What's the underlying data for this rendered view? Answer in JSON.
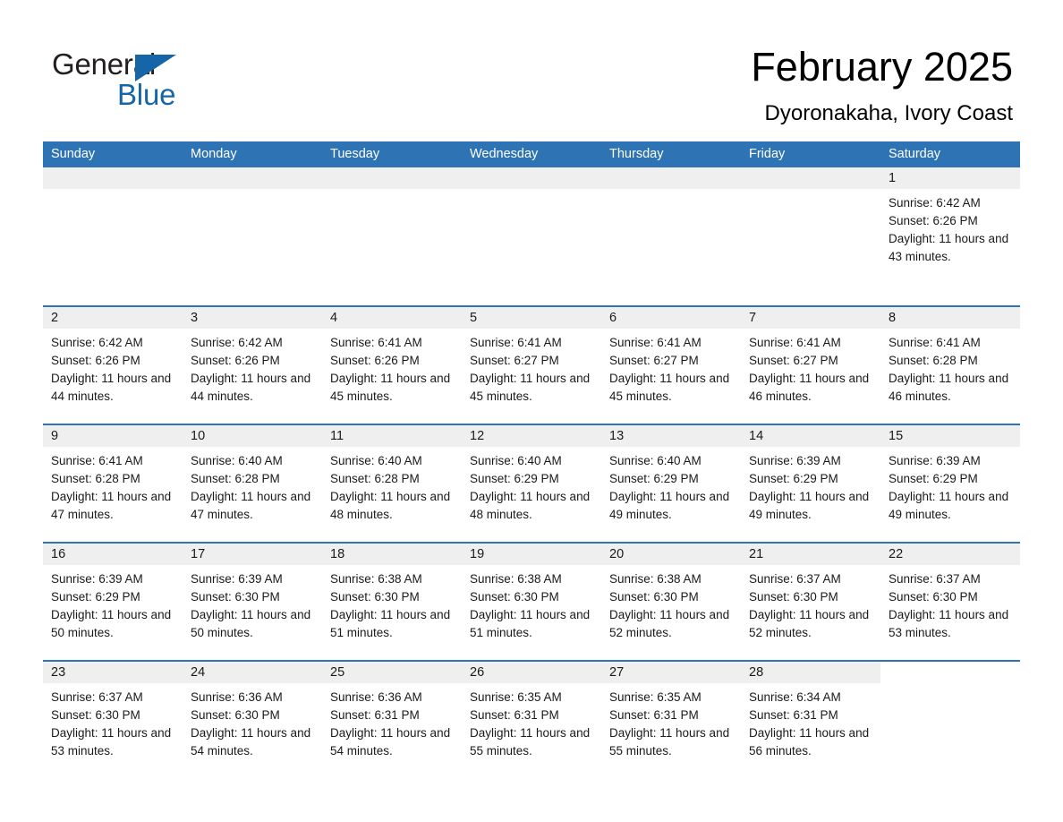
{
  "brand": {
    "name_part1": "General",
    "name_part2": "Blue",
    "accent_color": "#1565a8",
    "triangle_icon": "triangle-icon"
  },
  "header": {
    "title": "February 2025",
    "subtitle": "Dyoronakaha, Ivory Coast"
  },
  "calendar": {
    "header_color": "#2e74b5",
    "daynum_band_color": "#efefef",
    "weekdays": [
      "Sunday",
      "Monday",
      "Tuesday",
      "Wednesday",
      "Thursday",
      "Friday",
      "Saturday"
    ],
    "weeks": [
      [
        {
          "day": "",
          "lines": []
        },
        {
          "day": "",
          "lines": []
        },
        {
          "day": "",
          "lines": []
        },
        {
          "day": "",
          "lines": []
        },
        {
          "day": "",
          "lines": []
        },
        {
          "day": "",
          "lines": []
        },
        {
          "day": "1",
          "lines": [
            "Sunrise: 6:42 AM",
            "Sunset: 6:26 PM",
            "Daylight: 11 hours and 43 minutes."
          ]
        }
      ],
      [
        {
          "day": "2",
          "lines": [
            "Sunrise: 6:42 AM",
            "Sunset: 6:26 PM",
            "Daylight: 11 hours and 44 minutes."
          ]
        },
        {
          "day": "3",
          "lines": [
            "Sunrise: 6:42 AM",
            "Sunset: 6:26 PM",
            "Daylight: 11 hours and 44 minutes."
          ]
        },
        {
          "day": "4",
          "lines": [
            "Sunrise: 6:41 AM",
            "Sunset: 6:26 PM",
            "Daylight: 11 hours and 45 minutes."
          ]
        },
        {
          "day": "5",
          "lines": [
            "Sunrise: 6:41 AM",
            "Sunset: 6:27 PM",
            "Daylight: 11 hours and 45 minutes."
          ]
        },
        {
          "day": "6",
          "lines": [
            "Sunrise: 6:41 AM",
            "Sunset: 6:27 PM",
            "Daylight: 11 hours and 45 minutes."
          ]
        },
        {
          "day": "7",
          "lines": [
            "Sunrise: 6:41 AM",
            "Sunset: 6:27 PM",
            "Daylight: 11 hours and 46 minutes."
          ]
        },
        {
          "day": "8",
          "lines": [
            "Sunrise: 6:41 AM",
            "Sunset: 6:28 PM",
            "Daylight: 11 hours and 46 minutes."
          ]
        }
      ],
      [
        {
          "day": "9",
          "lines": [
            "Sunrise: 6:41 AM",
            "Sunset: 6:28 PM",
            "Daylight: 11 hours and 47 minutes."
          ]
        },
        {
          "day": "10",
          "lines": [
            "Sunrise: 6:40 AM",
            "Sunset: 6:28 PM",
            "Daylight: 11 hours and 47 minutes."
          ]
        },
        {
          "day": "11",
          "lines": [
            "Sunrise: 6:40 AM",
            "Sunset: 6:28 PM",
            "Daylight: 11 hours and 48 minutes."
          ]
        },
        {
          "day": "12",
          "lines": [
            "Sunrise: 6:40 AM",
            "Sunset: 6:29 PM",
            "Daylight: 11 hours and 48 minutes."
          ]
        },
        {
          "day": "13",
          "lines": [
            "Sunrise: 6:40 AM",
            "Sunset: 6:29 PM",
            "Daylight: 11 hours and 49 minutes."
          ]
        },
        {
          "day": "14",
          "lines": [
            "Sunrise: 6:39 AM",
            "Sunset: 6:29 PM",
            "Daylight: 11 hours and 49 minutes."
          ]
        },
        {
          "day": "15",
          "lines": [
            "Sunrise: 6:39 AM",
            "Sunset: 6:29 PM",
            "Daylight: 11 hours and 49 minutes."
          ]
        }
      ],
      [
        {
          "day": "16",
          "lines": [
            "Sunrise: 6:39 AM",
            "Sunset: 6:29 PM",
            "Daylight: 11 hours and 50 minutes."
          ]
        },
        {
          "day": "17",
          "lines": [
            "Sunrise: 6:39 AM",
            "Sunset: 6:30 PM",
            "Daylight: 11 hours and 50 minutes."
          ]
        },
        {
          "day": "18",
          "lines": [
            "Sunrise: 6:38 AM",
            "Sunset: 6:30 PM",
            "Daylight: 11 hours and 51 minutes."
          ]
        },
        {
          "day": "19",
          "lines": [
            "Sunrise: 6:38 AM",
            "Sunset: 6:30 PM",
            "Daylight: 11 hours and 51 minutes."
          ]
        },
        {
          "day": "20",
          "lines": [
            "Sunrise: 6:38 AM",
            "Sunset: 6:30 PM",
            "Daylight: 11 hours and 52 minutes."
          ]
        },
        {
          "day": "21",
          "lines": [
            "Sunrise: 6:37 AM",
            "Sunset: 6:30 PM",
            "Daylight: 11 hours and 52 minutes."
          ]
        },
        {
          "day": "22",
          "lines": [
            "Sunrise: 6:37 AM",
            "Sunset: 6:30 PM",
            "Daylight: 11 hours and 53 minutes."
          ]
        }
      ],
      [
        {
          "day": "23",
          "lines": [
            "Sunrise: 6:37 AM",
            "Sunset: 6:30 PM",
            "Daylight: 11 hours and 53 minutes."
          ]
        },
        {
          "day": "24",
          "lines": [
            "Sunrise: 6:36 AM",
            "Sunset: 6:30 PM",
            "Daylight: 11 hours and 54 minutes."
          ]
        },
        {
          "day": "25",
          "lines": [
            "Sunrise: 6:36 AM",
            "Sunset: 6:31 PM",
            "Daylight: 11 hours and 54 minutes."
          ]
        },
        {
          "day": "26",
          "lines": [
            "Sunrise: 6:35 AM",
            "Sunset: 6:31 PM",
            "Daylight: 11 hours and 55 minutes."
          ]
        },
        {
          "day": "27",
          "lines": [
            "Sunrise: 6:35 AM",
            "Sunset: 6:31 PM",
            "Daylight: 11 hours and 55 minutes."
          ]
        },
        {
          "day": "28",
          "lines": [
            "Sunrise: 6:34 AM",
            "Sunset: 6:31 PM",
            "Daylight: 11 hours and 56 minutes."
          ]
        },
        {
          "day": "",
          "lines": []
        }
      ]
    ]
  }
}
